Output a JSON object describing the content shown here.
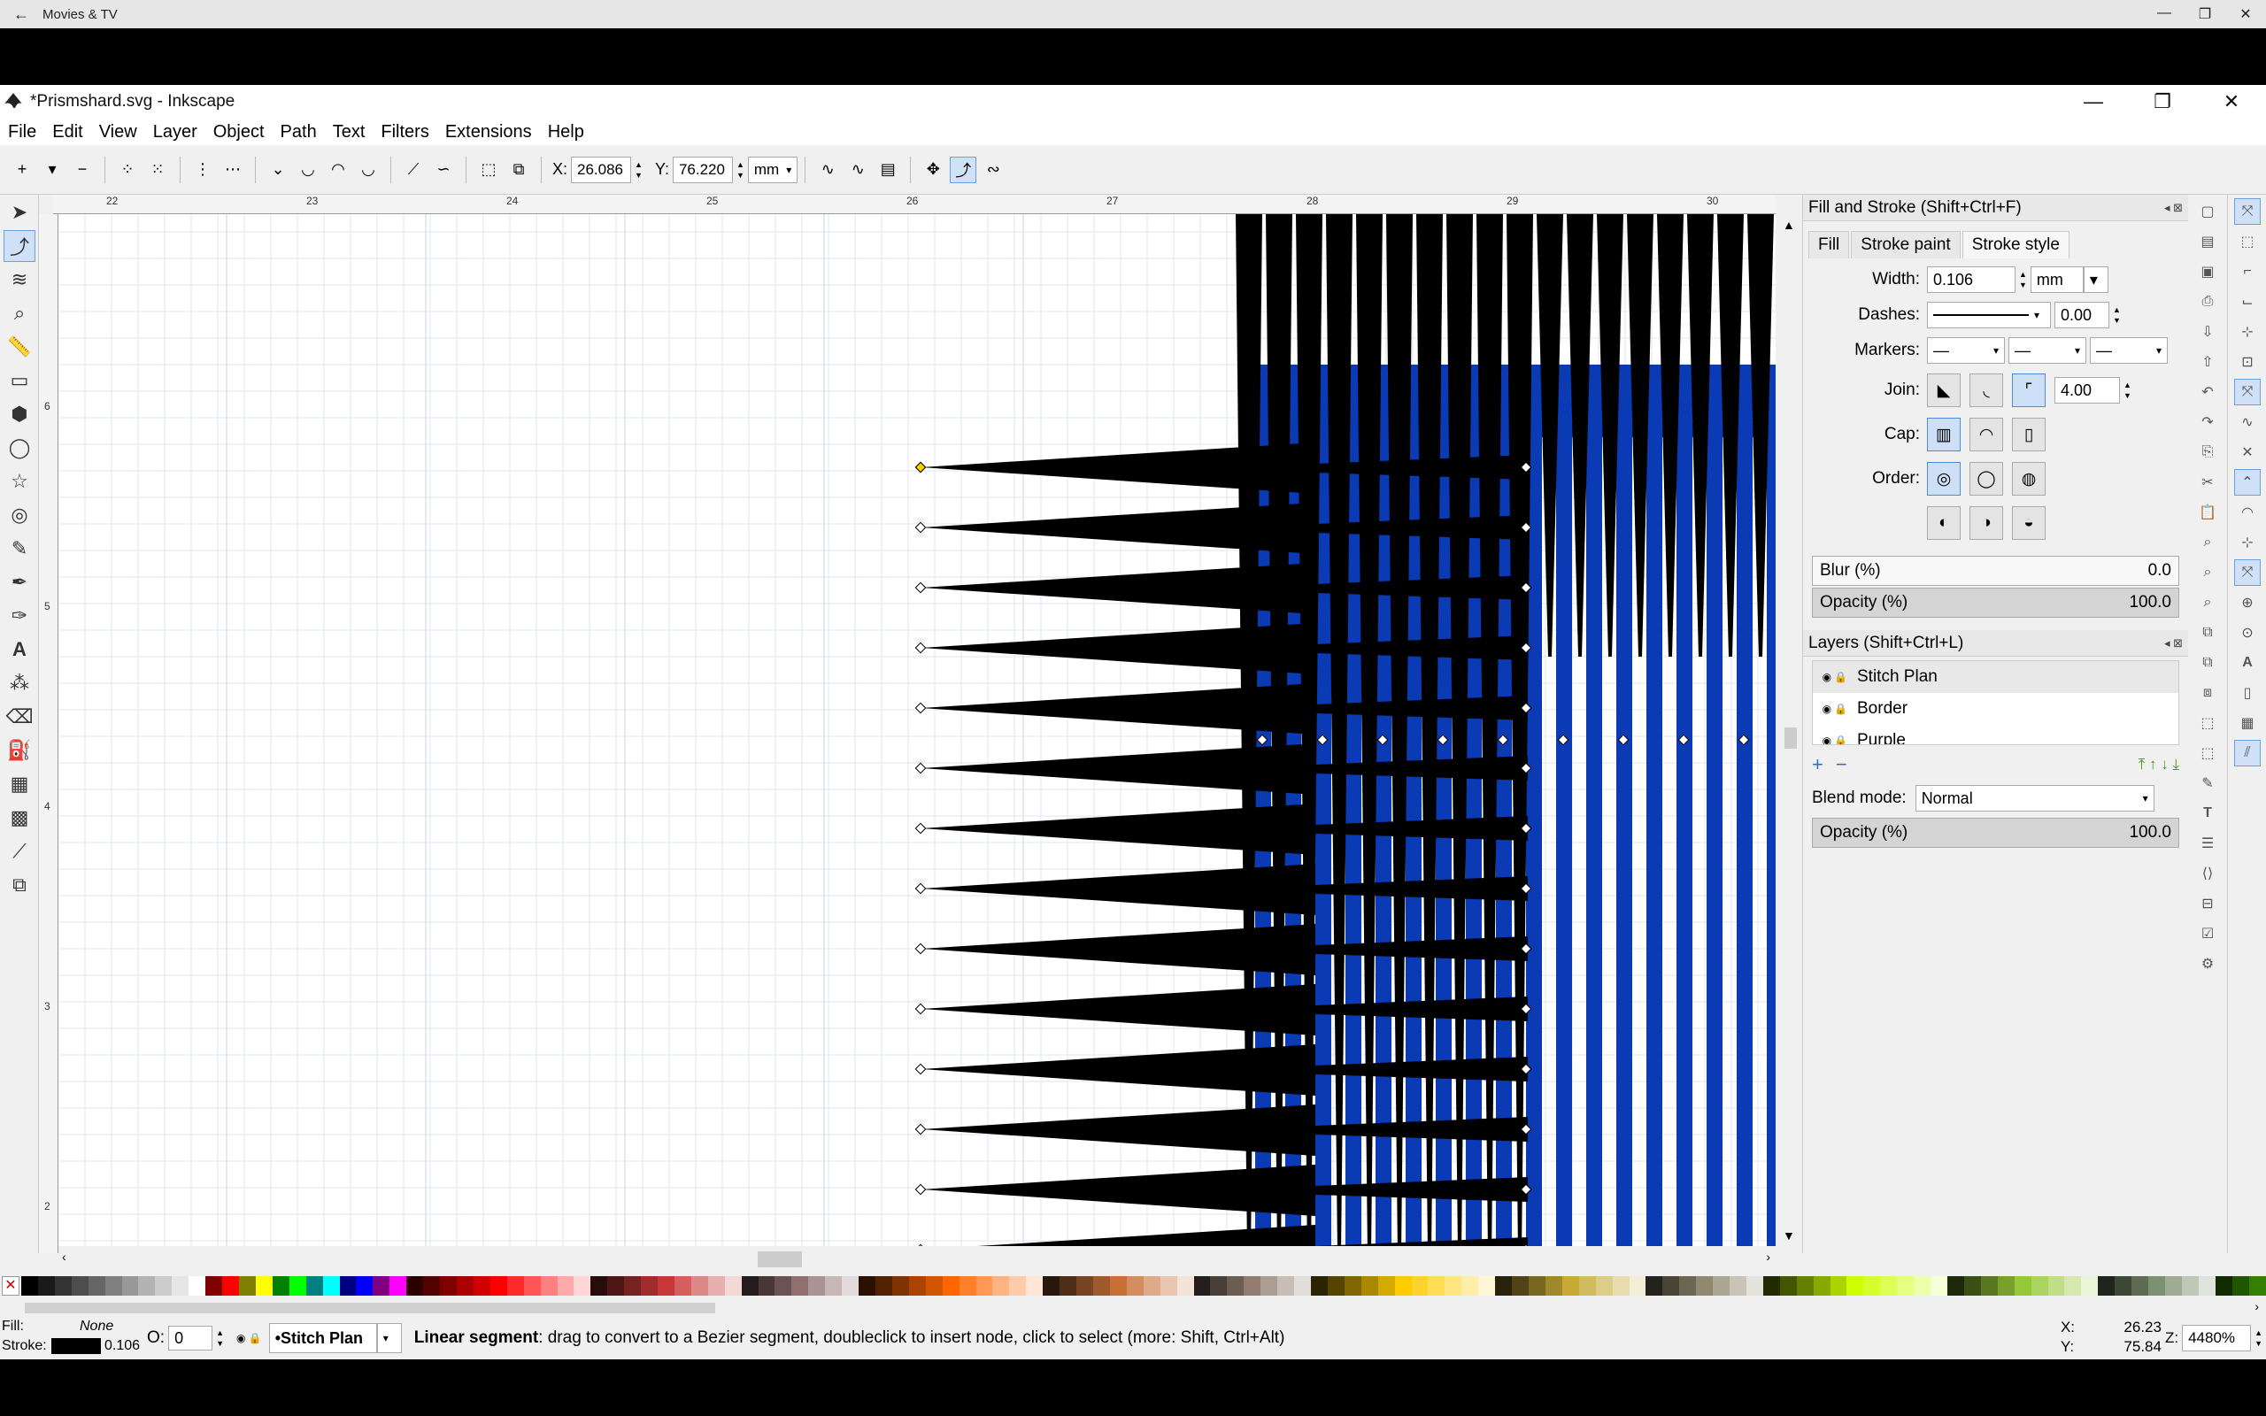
{
  "outer": {
    "title": "Movies & TV",
    "back": "←",
    "min": "—",
    "max": "❐",
    "close": "✕"
  },
  "window": {
    "title": "*Prismshard.svg - Inkscape",
    "min": "—",
    "max": "❐",
    "close": "✕"
  },
  "menu": [
    "File",
    "Edit",
    "View",
    "Layer",
    "Object",
    "Path",
    "Text",
    "Filters",
    "Extensions",
    "Help"
  ],
  "toolbar": {
    "x_label": "X:",
    "x_value": "26.086",
    "y_label": "Y:",
    "y_value": "76.220",
    "unit": "mm"
  },
  "rulers": {
    "h": [
      "22",
      "23",
      "24",
      "25",
      "26",
      "27",
      "28",
      "29",
      "30"
    ],
    "v": [
      "6",
      "5",
      "4",
      "3",
      "2"
    ]
  },
  "fill_stroke": {
    "title": "Fill and Stroke (Shift+Ctrl+F)",
    "tabs": [
      "Fill",
      "Stroke paint",
      "Stroke style"
    ],
    "width_label": "Width:",
    "width_value": "0.106",
    "width_unit": "mm",
    "dashes_label": "Dashes:",
    "dashes_value": "0.00",
    "markers_label": "Markers:",
    "join_label": "Join:",
    "join_value": "4.00",
    "cap_label": "Cap:",
    "order_label": "Order:",
    "blur_label": "Blur (%)",
    "blur_value": "0.0",
    "opacity_label": "Opacity (%)",
    "opacity_value": "100.0"
  },
  "layers": {
    "title": "Layers (Shift+Ctrl+L)",
    "items": [
      "Stitch Plan",
      "Border",
      "Purple"
    ],
    "blend_label": "Blend mode:",
    "blend_value": "Normal",
    "opacity_label": "Opacity (%)",
    "opacity_value": "100.0"
  },
  "status": {
    "fill_label": "Fill:",
    "fill_value": "None",
    "stroke_label": "Stroke:",
    "stroke_width": "0.106",
    "o_label": "O:",
    "o_value": "0",
    "layer": "•Stitch Plan",
    "message_bold": "Linear segment",
    "message": ": drag to convert to a Bezier segment, doubleclick to insert node, click to select (more: Shift, Ctrl+Alt)",
    "x_label": "X:",
    "x_value": "26.23",
    "y_label": "Y:",
    "y_value": "75.84",
    "z_label": "Z:",
    "zoom": "4480%"
  },
  "colors": {
    "blue": "#0a3bb5",
    "black": "#000000",
    "accent": "#4f8ad8"
  },
  "palette": [
    "#000000",
    "#1a1a1a",
    "#333333",
    "#4d4d4d",
    "#666666",
    "#808080",
    "#999999",
    "#b3b3b3",
    "#cccccc",
    "#e6e6e6",
    "#ffffff",
    "#800000",
    "#ff0000",
    "#808000",
    "#ffff00",
    "#008000",
    "#00ff00",
    "#008080",
    "#00ffff",
    "#000080",
    "#0000ff",
    "#800080",
    "#ff00ff",
    "#2b0000",
    "#550000",
    "#800000",
    "#aa0000",
    "#d40000",
    "#ff0000",
    "#ff2a2a",
    "#ff5555",
    "#ff8080",
    "#ffaaaa",
    "#ffd5d5",
    "#280b0b",
    "#501616",
    "#782121",
    "#a02c2c",
    "#c83737",
    "#d35f5f",
    "#de8787",
    "#e9afaf",
    "#f4d7d7",
    "#241c1c",
    "#483737",
    "#6c5353",
    "#916f6f",
    "#ac9393",
    "#c8b7b7",
    "#e3dbdb",
    "#2b1100",
    "#552200",
    "#803300",
    "#aa4400",
    "#d45500",
    "#ff6600",
    "#ff7f2a",
    "#ff9955",
    "#ffb380",
    "#ffccaa",
    "#ffe6d5",
    "#28170b",
    "#502d16",
    "#784421",
    "#a05a2c",
    "#c87137",
    "#d38d5f",
    "#deaa87",
    "#e9c6af",
    "#f4e3d7",
    "#241f1c",
    "#483e37",
    "#6c5d53",
    "#917c6f",
    "#ac9d93",
    "#c8beb7",
    "#e3dedb",
    "#2b2200",
    "#554400",
    "#806600",
    "#aa8800",
    "#d4aa00",
    "#ffcc00",
    "#ffd42a",
    "#ffdd55",
    "#ffe680",
    "#ffeeaa",
    "#fff6d5",
    "#28220b",
    "#504416",
    "#786721",
    "#a0892c",
    "#c8ab37",
    "#d3bc5f",
    "#decd87",
    "#e9ddaf",
    "#f4eed7",
    "#24221c",
    "#484537",
    "#6c6753",
    "#91896f",
    "#aca793",
    "#c8c4b7",
    "#e3e2db",
    "#222b00",
    "#445500",
    "#668000",
    "#88aa00",
    "#aad400",
    "#ccff00",
    "#d4ff2a",
    "#ddff55",
    "#e5ff80",
    "#eeffaa",
    "#f6ffd5",
    "#1e280b",
    "#3c5016",
    "#5a7821",
    "#78a02c",
    "#96c837",
    "#abd35f",
    "#c0de87",
    "#d5e9af",
    "#eaf4d7",
    "#1f241c",
    "#3e4837",
    "#5d6c53",
    "#7c916f",
    "#9dac93",
    "#bec8b7",
    "#dee3db",
    "#112b00",
    "#225500",
    "#338000"
  ]
}
